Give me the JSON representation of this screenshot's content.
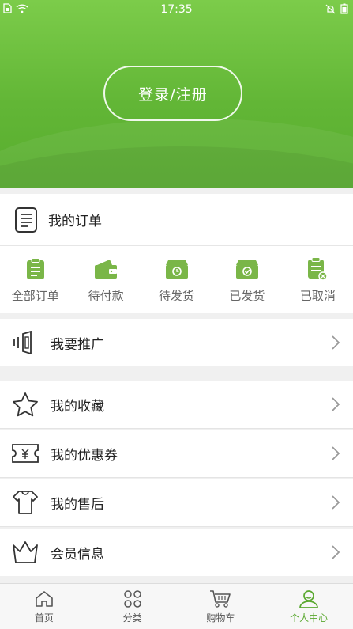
{
  "status_bar": {
    "time": "17:35"
  },
  "header": {
    "login_label": "登录/注册"
  },
  "orders": {
    "title": "我的订单",
    "statuses": [
      {
        "label": "全部订单",
        "icon": "clipboard-icon"
      },
      {
        "label": "待付款",
        "icon": "wallet-icon"
      },
      {
        "label": "待发货",
        "icon": "clock-box-icon"
      },
      {
        "label": "已发货",
        "icon": "check-box-icon"
      },
      {
        "label": "已取消",
        "icon": "cancel-doc-icon"
      }
    ]
  },
  "menu": {
    "promote": "我要推广",
    "favorites": "我的收藏",
    "coupons": "我的优惠券",
    "after_sales": "我的售后",
    "member_info": "会员信息"
  },
  "tabbar": {
    "tabs": [
      {
        "label": "首页",
        "icon": "home-icon"
      },
      {
        "label": "分类",
        "icon": "category-icon"
      },
      {
        "label": "购物车",
        "icon": "cart-icon"
      },
      {
        "label": "个人中心",
        "icon": "user-icon"
      }
    ],
    "active_index": 3
  },
  "colors": {
    "brand_green": "#5aa82f",
    "icon_green": "#7ab648"
  }
}
